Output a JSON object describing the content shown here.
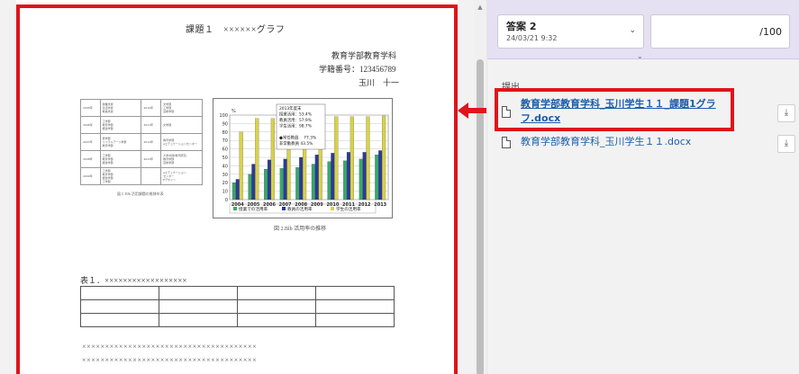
{
  "document": {
    "title": "課題１　××××××グラフ",
    "department": "教育学部教育学科",
    "student_id": "学籍番号：123456789",
    "author": "玉川　十一",
    "figure1_caption": "図１.Blb 活用課題の推移年表",
    "figure2_caption": "図 2.Blb 活用率の推移",
    "table_years": [
      "2005年",
      "2006年",
      "2007年",
      "2008年",
      "2009年"
    ],
    "table_events": [
      "授業支援\n生活支援\n教員支援",
      "工学部\n教育学部\n経営学部",
      "農学部\nリベラルアーツ学部\n教育学部",
      "工学部\n教育学部\n経営学部",
      "工学部\n教育学部\n経営学部\n工学部"
    ],
    "table_years_b": [
      "2010年",
      "2011年",
      "2012年",
      "2013年",
      ""
    ],
    "table_events_b": [
      "文学部\n工学部\n芸術学部",
      "文学部",
      "教育学部\neエデュケーションセンター",
      "大学共通(教育研究)\n教育学部\n芸術学部",
      "eエデュケーション\nセンター\nEデザイン"
    ],
    "table1_caption": "表１．××××××××××××××××××",
    "x_line_1": "××××××××××××××××××××××××××××××××××××××",
    "x_line_2": "××××××××××××××××××××××××××××××××××××××"
  },
  "chart_data": {
    "type": "bar",
    "categories": [
      "2004",
      "2005",
      "2006",
      "2007",
      "2008",
      "2009",
      "2010",
      "2011",
      "2012",
      "2013"
    ],
    "ylim": [
      0,
      100
    ],
    "yticks": [
      0,
      10,
      20,
      30,
      40,
      50,
      60,
      70,
      80,
      90,
      100
    ],
    "ylabel": "%",
    "series": [
      {
        "name": "授業での活用率",
        "color": "#39a86b",
        "values": [
          20,
          30,
          36,
          37,
          38,
          42,
          45,
          46,
          48,
          53
        ]
      },
      {
        "name": "教員の活用率",
        "color": "#2b3a99",
        "values": [
          24,
          42,
          47,
          48,
          50,
          53,
          55,
          56,
          56,
          58
        ]
      },
      {
        "name": "学生の活用率",
        "color": "#d8d24a",
        "values": [
          80,
          96,
          96,
          97,
          98,
          98,
          98,
          98,
          98,
          99
        ]
      }
    ],
    "annotation": {
      "lines": [
        "2013年度末",
        "授業活用：53.4%",
        "教員活用：57.9%",
        "学生活用：98.7%",
        "",
        "●常任教員　 77.3%",
        "非常勤教員 43.5%"
      ]
    }
  },
  "panel": {
    "draft_name": "答案 2",
    "draft_date": "24/03/21 9:32",
    "score_value": "",
    "score_total": "/100",
    "submission_label": "提出",
    "files": [
      {
        "name": "教育学部教育学科_玉川学生１１_課題1グラフ.docx",
        "line1": "教育学部教育学科_玉川学生１１_課題1グラ",
        "line2": "フ.docx"
      },
      {
        "name": "教育学部教育学科_玉川学生１１.docx"
      }
    ]
  },
  "colors": {
    "highlight": "#e0141b",
    "link": "#1d5da8",
    "grade_bar": "#e6e0f3"
  },
  "icons": {
    "chevron": "chevron-down-icon",
    "file": "file-icon",
    "download": "download-icon",
    "arrow": "left-arrow-icon"
  }
}
